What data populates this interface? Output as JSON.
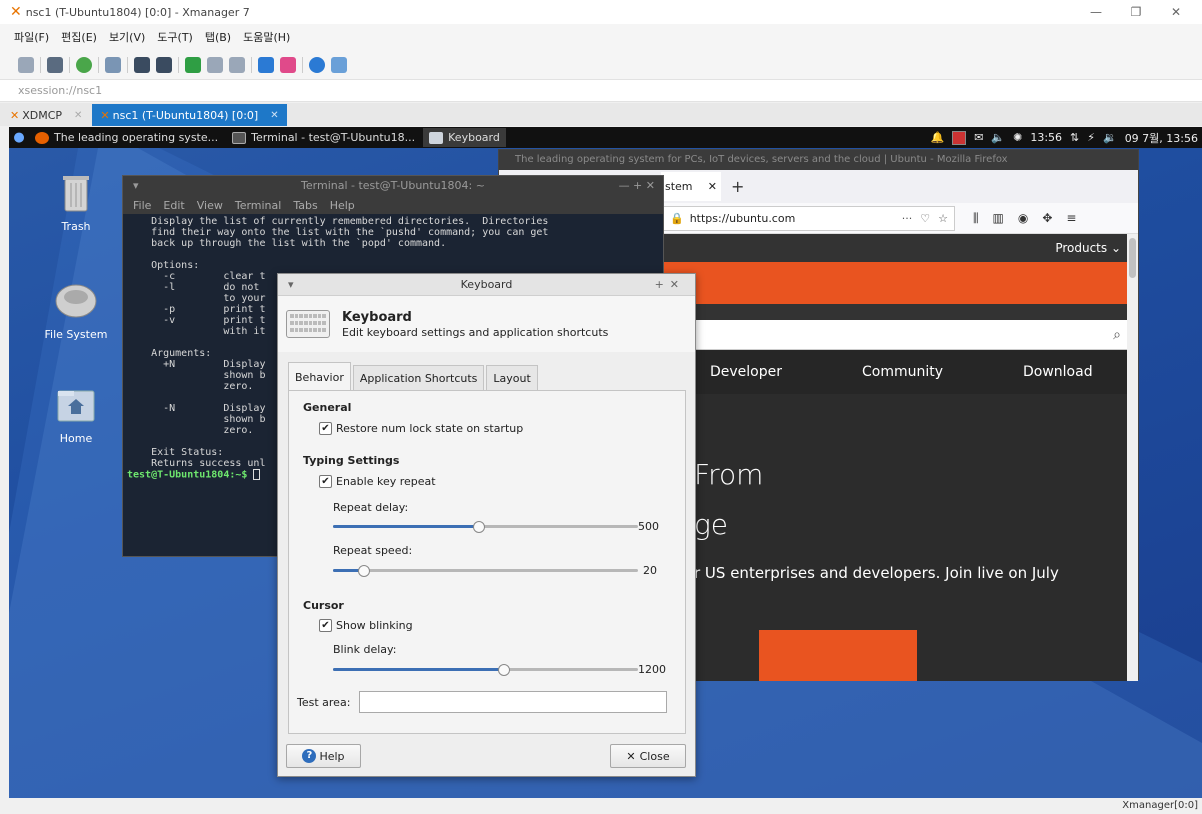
{
  "host": {
    "title": "nsc1 (T-Ubuntu1804) [0:0] - Xmanager 7",
    "menu": [
      "파일(F)",
      "편집(E)",
      "보기(V)",
      "도구(T)",
      "탭(B)",
      "도움말(H)"
    ],
    "address": "xsession://nsc1",
    "tabs": [
      {
        "label": "XDMCP",
        "active": false
      },
      {
        "label": "nsc1 (T-Ubuntu1804) [0:0]",
        "active": true
      }
    ],
    "status": "Xmanager[0:0]"
  },
  "panel": {
    "tasks": [
      {
        "label": "The leading operating syste...",
        "icon": "firefox-icon"
      },
      {
        "label": "Terminal - test@T-Ubuntu18...",
        "icon": "terminal-icon"
      },
      {
        "label": "Keyboard",
        "icon": "keyboard-icon"
      }
    ],
    "clock_small": "13:56",
    "clock": "09 7월, 13:56"
  },
  "desktop": {
    "icons": [
      {
        "label": "Trash"
      },
      {
        "label": "File System"
      },
      {
        "label": "Home"
      }
    ]
  },
  "terminal": {
    "title": "Terminal - test@T-Ubuntu1804: ~",
    "menu": [
      "File",
      "Edit",
      "View",
      "Terminal",
      "Tabs",
      "Help"
    ],
    "lines": [
      "    Display the list of currently remembered directories.  Directories",
      "    find their way onto the list with the `pushd' command; you can get",
      "    back up through the list with the `popd' command.",
      "",
      "    Options:",
      "      -c        clear t",
      "      -l        do not ",
      "                to your",
      "      -p        print t",
      "      -v        print t",
      "                with it",
      "",
      "    Arguments:",
      "      +N        Display",
      "                shown b",
      "                zero.",
      "",
      "      -N        Display",
      "                shown b",
      "                zero.",
      "",
      "    Exit Status:",
      "    Returns success unl"
    ],
    "prompt": "test@T-Ubuntu1804:~$"
  },
  "firefox": {
    "title": "The leading operating system for PCs, IoT devices, servers and the cloud | Ubuntu - Mozilla Firefox",
    "tab_label": "stem",
    "url": "https://ubuntu.com",
    "menu_products": "Products ⌄",
    "nav": [
      "Developer",
      "Community",
      "Download"
    ],
    "hero_line1": "From",
    "hero_line2": "ge",
    "hero_text": "r US enterprises and developers. Join live on July"
  },
  "keyboard": {
    "window_title": "Keyboard",
    "heading": "Keyboard",
    "subheading": "Edit keyboard settings and application shortcuts",
    "tabs": [
      "Behavior",
      "Application Shortcuts",
      "Layout"
    ],
    "sections": {
      "general": "General",
      "typing": "Typing Settings",
      "cursor": "Cursor"
    },
    "restore_numlock": {
      "label": "Restore num lock state on startup",
      "checked": true
    },
    "key_repeat": {
      "label": "Enable key repeat",
      "checked": true
    },
    "repeat_delay": {
      "label": "Repeat delay:",
      "value": "500",
      "fraction": 0.48
    },
    "repeat_speed": {
      "label": "Repeat speed:",
      "value": "20",
      "fraction": 0.1
    },
    "show_blinking": {
      "label": "Show blinking",
      "checked": true
    },
    "blink_delay": {
      "label": "Blink delay:",
      "value": "1200",
      "fraction": 0.56
    },
    "test_area_label": "Test area:",
    "test_area_value": "",
    "help_label": "Help",
    "close_label": "Close"
  },
  "colors": {
    "accent": "#3c6fb4",
    "ubuntu_orange": "#e95420",
    "desktop_blue": "#1f4ea0"
  }
}
